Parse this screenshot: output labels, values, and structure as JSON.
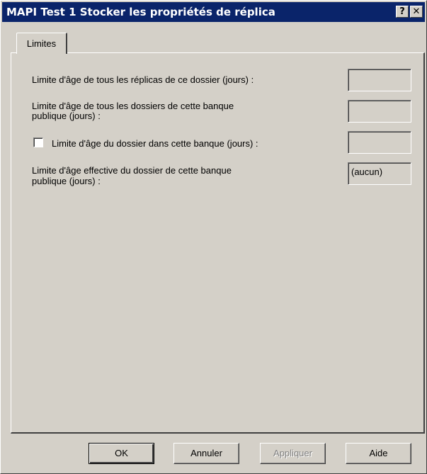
{
  "window": {
    "title": "MAPI Test 1 Stocker les propriétés de réplica",
    "help_glyph": "?",
    "close_glyph": "✕"
  },
  "tabs": [
    {
      "label": "Limites"
    }
  ],
  "limits": {
    "replica_age_label": "Limite d'âge de tous les réplicas de ce dossier (jours) :",
    "replica_age_value": "",
    "folders_age_label_line1": "Limite d'âge de tous les dossiers de cette banque",
    "folders_age_label_line2": "publique (jours) :",
    "folders_age_value": "",
    "folder_age_checkbox_label": "Limite d'âge du dossier dans cette banque (jours) :",
    "folder_age_checked": false,
    "folder_age_value": "",
    "effective_age_label_line1": "Limite d'âge effective du dossier de cette banque",
    "effective_age_label_line2": "publique (jours) :",
    "effective_age_value": "(aucun)"
  },
  "buttons": {
    "ok": "OK",
    "cancel": "Annuler",
    "apply": "Appliquer",
    "help": "Aide"
  }
}
